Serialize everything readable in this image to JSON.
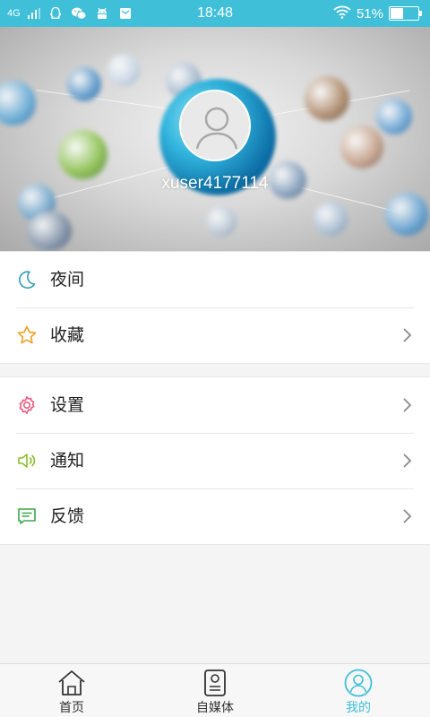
{
  "status_bar": {
    "network": "4G",
    "time": "18:48",
    "battery_percent": "51%",
    "battery_level": 0.51,
    "notification_icons": [
      "qq-icon",
      "wechat-icon",
      "android-icon",
      "mail-icon"
    ]
  },
  "profile": {
    "username": "xuser4177114",
    "avatar_icon": "default-user-icon"
  },
  "menu": {
    "group1": [
      {
        "label": "夜间",
        "icon": "moon-icon",
        "color": "#2f9ab8",
        "chevron": false
      },
      {
        "label": "收藏",
        "icon": "star-icon",
        "color": "#f0a020",
        "chevron": true
      }
    ],
    "group2": [
      {
        "label": "设置",
        "icon": "gear-icon",
        "color": "#e8557a",
        "chevron": true
      },
      {
        "label": "通知",
        "icon": "speaker-icon",
        "color": "#8bbd2a",
        "chevron": true
      },
      {
        "label": "反馈",
        "icon": "message-icon",
        "color": "#3aa84a",
        "chevron": true
      }
    ]
  },
  "tabbar": {
    "tabs": [
      {
        "label": "首页",
        "icon": "home-icon",
        "active": false
      },
      {
        "label": "自媒体",
        "icon": "media-icon",
        "active": false
      },
      {
        "label": "我的",
        "icon": "profile-icon",
        "active": true
      }
    ],
    "active_color": "#3fbfd8"
  },
  "colors": {
    "status_bar": "#3fbfd8",
    "background": "#f4f4f4"
  }
}
